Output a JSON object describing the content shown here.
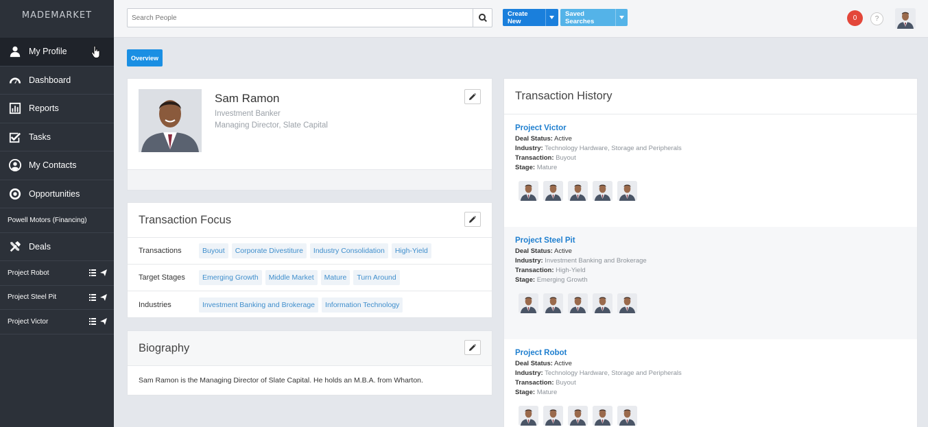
{
  "brand": "MADEMARKET",
  "nav": {
    "items": [
      {
        "label": "My Profile",
        "icon": "user-icon"
      },
      {
        "label": "Dashboard",
        "icon": "gauge-icon"
      },
      {
        "label": "Reports",
        "icon": "bar-chart-icon"
      },
      {
        "label": "Tasks",
        "icon": "check-square-icon"
      },
      {
        "label": "My Contacts",
        "icon": "contact-circle-icon"
      },
      {
        "label": "Opportunities",
        "icon": "target-icon"
      }
    ],
    "opportunity_sub": "Powell Motors (Financing)",
    "deals_label": "Deals",
    "deal_items": [
      "Project Robot",
      "Project Steel Pit",
      "Project Victor"
    ]
  },
  "topbar": {
    "search_placeholder": "Search People",
    "create_label": "Create New",
    "saved_label": "Saved Searches",
    "notification_count": "0",
    "help": "?"
  },
  "tabs": {
    "overview": "Overview"
  },
  "profile": {
    "name": "Sam Ramon",
    "role": "Investment Banker",
    "company": "Managing Director, Slate Capital"
  },
  "focus": {
    "title": "Transaction Focus",
    "rows": [
      {
        "label": "Transactions",
        "chips": [
          "Buyout",
          "Corporate Divestiture",
          "Industry Consolidation",
          "High-Yield"
        ]
      },
      {
        "label": "Target Stages",
        "chips": [
          "Emerging Growth",
          "Middle Market",
          "Mature",
          "Turn Around"
        ]
      },
      {
        "label": "Industries",
        "chips": [
          "Investment Banking and Brokerage",
          "Information Technology"
        ]
      }
    ]
  },
  "biography": {
    "title": "Biography",
    "text": "Sam Ramon is the Managing Director of Slate Capital. He holds an M.B.A. from Wharton."
  },
  "history": {
    "title": "Transaction History",
    "labels": {
      "status": "Deal Status:",
      "industry": "Industry:",
      "transaction": "Transaction:",
      "stage": "Stage:"
    },
    "projects": [
      {
        "name": "Project Victor",
        "status": "Active",
        "industry": "Technology Hardware, Storage and Peripherals",
        "transaction": "Buyout",
        "stage": "Mature"
      },
      {
        "name": "Project Steel Pit",
        "status": "Active",
        "industry": "Investment Banking and Brokerage",
        "transaction": "High-Yield",
        "stage": "Emerging Growth"
      },
      {
        "name": "Project Robot",
        "status": "Active",
        "industry": "Technology Hardware, Storage and Peripherals",
        "transaction": "Buyout",
        "stage": "Mature"
      }
    ]
  },
  "colors": {
    "accent": "#1a7fdc",
    "link": "#1f7fcf",
    "sidebar": "#2c3139",
    "badge": "#e3473a"
  }
}
